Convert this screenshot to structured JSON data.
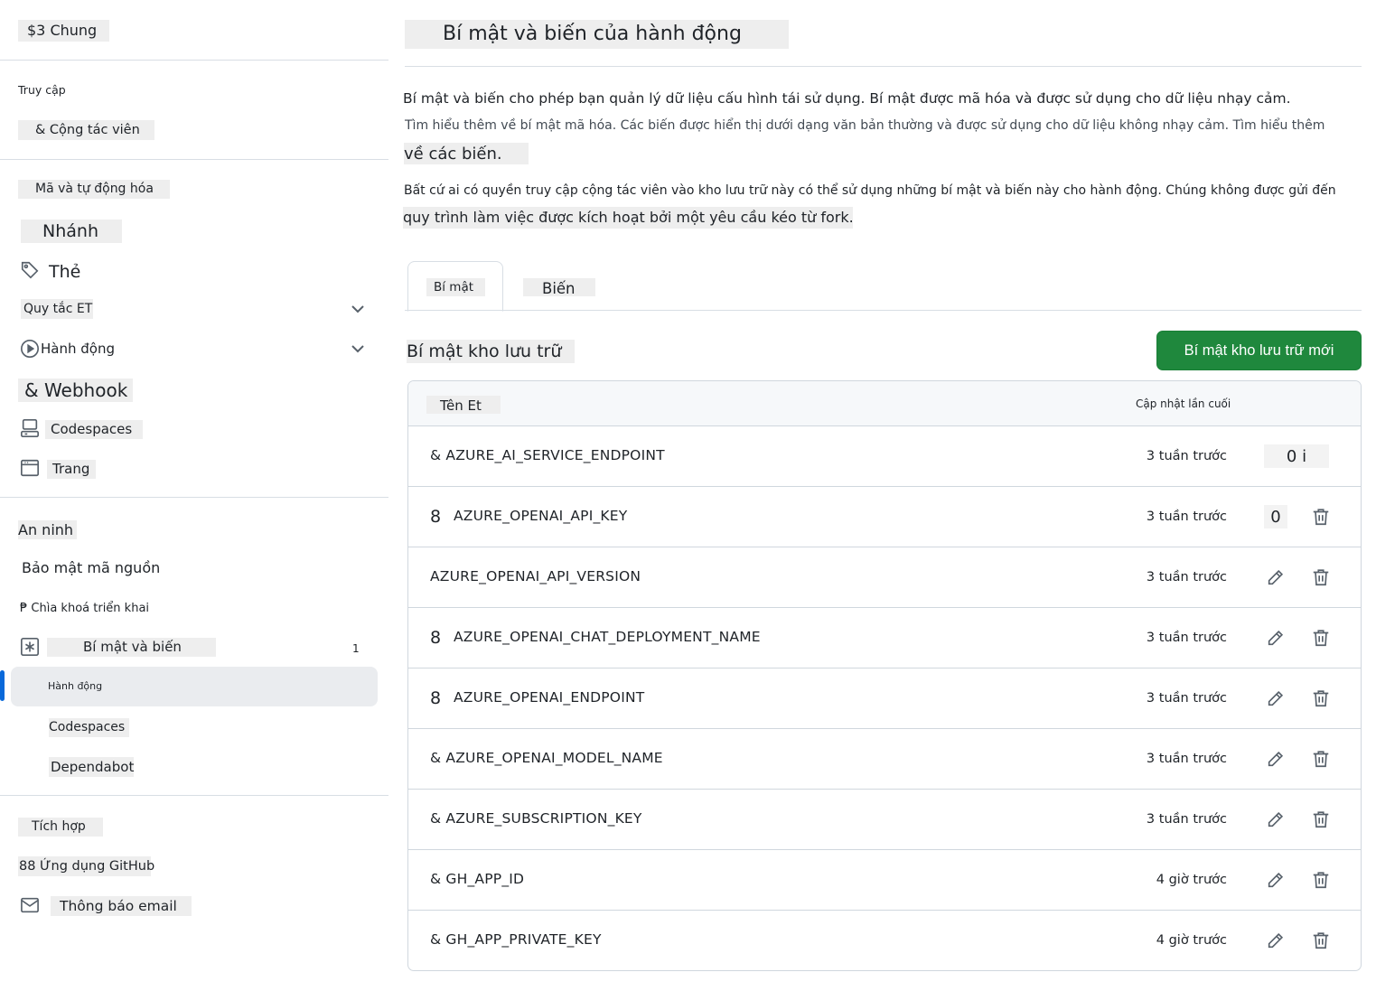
{
  "sidebar": {
    "general": "$3 Chung",
    "access_heading": "Truy cập",
    "collaborators": "& Cộng tác viên",
    "code_automation_heading": "Mã và tự động hóa",
    "branches": "Nhánh",
    "tags": "Thẻ",
    "rules": "Quy tắc ET",
    "actions": "Hành động",
    "webhooks": "& Webhook",
    "codespaces": "Codespaces",
    "pages": "Trang",
    "security_heading": "An ninh",
    "code_security": "Bảo mật mã nguồn",
    "deploy_keys": "₱ Chìa khoá triển khai",
    "secrets_variables": "Bí mật và biến",
    "secrets_variables_badge": "1",
    "sub_actions": "Hành động",
    "sub_codespaces": "Codespaces",
    "sub_dependabot": "Dependabot",
    "integrations_heading": "Tích hợp",
    "github_apps": "88 Ứng dụng GitHub",
    "email_notifications": "Thông báo email"
  },
  "main": {
    "title": "Bí mật và biến của hành động",
    "desc_line1": "Bí mật và biến cho phép bạn quản lý dữ liệu cấu hình tái sử dụng. Bí mật được mã hóa và được sử dụng cho dữ liệu nhạy cảm.",
    "desc_line2": "Tìm hiểu thêm về bí mật mã hóa. Các biến được hiển thị dưới dạng văn bản thường và được sử dụng cho dữ liệu không nhạy cảm. Tìm hiểu thêm",
    "desc_line3": "về các biến.",
    "note_line1": "Bất cứ ai có quyền truy cập cộng tác viên vào kho lưu trữ này có thể sử dụng những bí mật và biến này cho hành động. Chúng không được gửi đến",
    "note_line2": "quy trình làm việc được kích hoạt bởi một yêu cầu kéo từ fork.",
    "tabs": {
      "secrets": "Bí mật",
      "variables": "Biến"
    },
    "section_title": "Bí mật kho lưu trữ",
    "new_button": "Bí mật kho lưu trữ mới",
    "table": {
      "col_name": "Tên Et",
      "col_updated": "Cập nhật lần cuối",
      "rows": [
        {
          "name": "& AZURE_AI_SERVICE_ENDPOINT",
          "updated": "3 tuần trước",
          "edit_text": "0 i"
        },
        {
          "prefix": "8",
          "name": "AZURE_OPENAI_API_KEY",
          "updated": "3 tuần trước",
          "edit_text": "0"
        },
        {
          "name": "AZURE_OPENAI_API_VERSION",
          "updated": "3 tuần trước"
        },
        {
          "prefix": "8",
          "name": "AZURE_OPENAI_CHAT_DEPLOYMENT_NAME",
          "updated": "3 tuần trước"
        },
        {
          "prefix": "8",
          "name": "AZURE_OPENAI_ENDPOINT",
          "updated": "3 tuần trước"
        },
        {
          "name": "& AZURE_OPENAI_MODEL_NAME",
          "updated": "3 tuần trước"
        },
        {
          "name": "& AZURE_SUBSCRIPTION_KEY",
          "updated": "3 tuần trước"
        },
        {
          "name": "& GH_APP_ID",
          "updated": "4 giờ trước"
        },
        {
          "name": "& GH_APP_PRIVATE_KEY",
          "updated": "4 giờ trước"
        }
      ]
    }
  },
  "colors": {
    "accent_green": "#1f883d",
    "active_indicator": "#0969da"
  }
}
